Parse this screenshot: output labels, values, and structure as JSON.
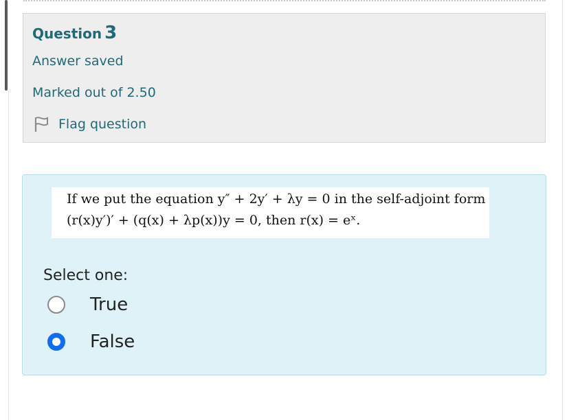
{
  "info": {
    "question_label": "Question",
    "question_number": "3",
    "state": "Answer saved",
    "grade": "Marked out of 2.50",
    "flag_label": "Flag question"
  },
  "question": {
    "text_line1": "If we put the equation y″ + 2y′ + λy = 0 in the self-adjoint form",
    "text_line2": "(r(x)y′)′ + (q(x) + λp(x))y = 0, then r(x) = eˣ.",
    "prompt": "Select one:",
    "options": [
      {
        "label": "True",
        "selected": false
      },
      {
        "label": "False",
        "selected": true
      }
    ]
  },
  "colors": {
    "info_text": "#1f6a77",
    "radio_selected": "#0f6cf6",
    "formulation_bg": "#def2f8"
  }
}
